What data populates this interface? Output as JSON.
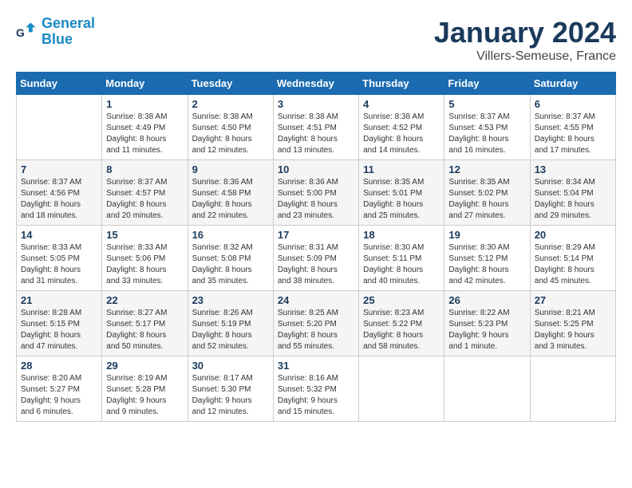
{
  "header": {
    "logo_line1": "General",
    "logo_line2": "Blue",
    "month": "January 2024",
    "location": "Villers-Semeuse, France"
  },
  "days_of_week": [
    "Sunday",
    "Monday",
    "Tuesday",
    "Wednesday",
    "Thursday",
    "Friday",
    "Saturday"
  ],
  "weeks": [
    [
      {
        "day": "",
        "info": ""
      },
      {
        "day": "1",
        "info": "Sunrise: 8:38 AM\nSunset: 4:49 PM\nDaylight: 8 hours\nand 11 minutes."
      },
      {
        "day": "2",
        "info": "Sunrise: 8:38 AM\nSunset: 4:50 PM\nDaylight: 8 hours\nand 12 minutes."
      },
      {
        "day": "3",
        "info": "Sunrise: 8:38 AM\nSunset: 4:51 PM\nDaylight: 8 hours\nand 13 minutes."
      },
      {
        "day": "4",
        "info": "Sunrise: 8:38 AM\nSunset: 4:52 PM\nDaylight: 8 hours\nand 14 minutes."
      },
      {
        "day": "5",
        "info": "Sunrise: 8:37 AM\nSunset: 4:53 PM\nDaylight: 8 hours\nand 16 minutes."
      },
      {
        "day": "6",
        "info": "Sunrise: 8:37 AM\nSunset: 4:55 PM\nDaylight: 8 hours\nand 17 minutes."
      }
    ],
    [
      {
        "day": "7",
        "info": "Sunrise: 8:37 AM\nSunset: 4:56 PM\nDaylight: 8 hours\nand 18 minutes."
      },
      {
        "day": "8",
        "info": "Sunrise: 8:37 AM\nSunset: 4:57 PM\nDaylight: 8 hours\nand 20 minutes."
      },
      {
        "day": "9",
        "info": "Sunrise: 8:36 AM\nSunset: 4:58 PM\nDaylight: 8 hours\nand 22 minutes."
      },
      {
        "day": "10",
        "info": "Sunrise: 8:36 AM\nSunset: 5:00 PM\nDaylight: 8 hours\nand 23 minutes."
      },
      {
        "day": "11",
        "info": "Sunrise: 8:35 AM\nSunset: 5:01 PM\nDaylight: 8 hours\nand 25 minutes."
      },
      {
        "day": "12",
        "info": "Sunrise: 8:35 AM\nSunset: 5:02 PM\nDaylight: 8 hours\nand 27 minutes."
      },
      {
        "day": "13",
        "info": "Sunrise: 8:34 AM\nSunset: 5:04 PM\nDaylight: 8 hours\nand 29 minutes."
      }
    ],
    [
      {
        "day": "14",
        "info": "Sunrise: 8:33 AM\nSunset: 5:05 PM\nDaylight: 8 hours\nand 31 minutes."
      },
      {
        "day": "15",
        "info": "Sunrise: 8:33 AM\nSunset: 5:06 PM\nDaylight: 8 hours\nand 33 minutes."
      },
      {
        "day": "16",
        "info": "Sunrise: 8:32 AM\nSunset: 5:08 PM\nDaylight: 8 hours\nand 35 minutes."
      },
      {
        "day": "17",
        "info": "Sunrise: 8:31 AM\nSunset: 5:09 PM\nDaylight: 8 hours\nand 38 minutes."
      },
      {
        "day": "18",
        "info": "Sunrise: 8:30 AM\nSunset: 5:11 PM\nDaylight: 8 hours\nand 40 minutes."
      },
      {
        "day": "19",
        "info": "Sunrise: 8:30 AM\nSunset: 5:12 PM\nDaylight: 8 hours\nand 42 minutes."
      },
      {
        "day": "20",
        "info": "Sunrise: 8:29 AM\nSunset: 5:14 PM\nDaylight: 8 hours\nand 45 minutes."
      }
    ],
    [
      {
        "day": "21",
        "info": "Sunrise: 8:28 AM\nSunset: 5:15 PM\nDaylight: 8 hours\nand 47 minutes."
      },
      {
        "day": "22",
        "info": "Sunrise: 8:27 AM\nSunset: 5:17 PM\nDaylight: 8 hours\nand 50 minutes."
      },
      {
        "day": "23",
        "info": "Sunrise: 8:26 AM\nSunset: 5:19 PM\nDaylight: 8 hours\nand 52 minutes."
      },
      {
        "day": "24",
        "info": "Sunrise: 8:25 AM\nSunset: 5:20 PM\nDaylight: 8 hours\nand 55 minutes."
      },
      {
        "day": "25",
        "info": "Sunrise: 8:23 AM\nSunset: 5:22 PM\nDaylight: 8 hours\nand 58 minutes."
      },
      {
        "day": "26",
        "info": "Sunrise: 8:22 AM\nSunset: 5:23 PM\nDaylight: 9 hours\nand 1 minute."
      },
      {
        "day": "27",
        "info": "Sunrise: 8:21 AM\nSunset: 5:25 PM\nDaylight: 9 hours\nand 3 minutes."
      }
    ],
    [
      {
        "day": "28",
        "info": "Sunrise: 8:20 AM\nSunset: 5:27 PM\nDaylight: 9 hours\nand 6 minutes."
      },
      {
        "day": "29",
        "info": "Sunrise: 8:19 AM\nSunset: 5:28 PM\nDaylight: 9 hours\nand 9 minutes."
      },
      {
        "day": "30",
        "info": "Sunrise: 8:17 AM\nSunset: 5:30 PM\nDaylight: 9 hours\nand 12 minutes."
      },
      {
        "day": "31",
        "info": "Sunrise: 8:16 AM\nSunset: 5:32 PM\nDaylight: 9 hours\nand 15 minutes."
      },
      {
        "day": "",
        "info": ""
      },
      {
        "day": "",
        "info": ""
      },
      {
        "day": "",
        "info": ""
      }
    ]
  ]
}
